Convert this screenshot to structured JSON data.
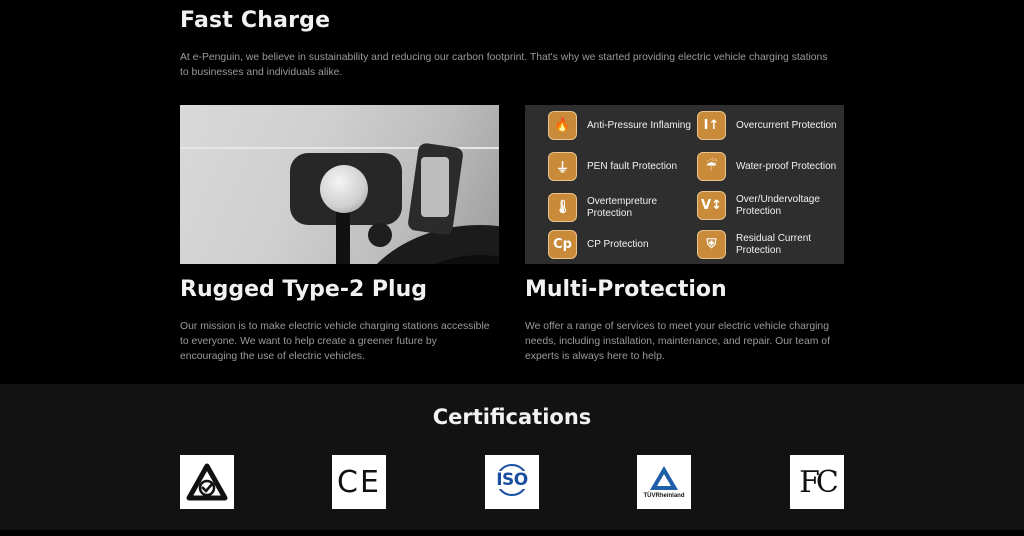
{
  "header": {
    "title": "Fast Charge"
  },
  "intro": {
    "text": "At e-Penguin, we believe in sustainability and reducing our carbon footprint. That's why we started providing electric vehicle charging stations to businesses and individuals alike."
  },
  "protections": [
    {
      "label": "Anti-Pressure Inflaming",
      "icon": "flame-icon",
      "glyph": "🔥"
    },
    {
      "label": "PEN fault Protection",
      "icon": "ground-icon",
      "glyph": "⏚"
    },
    {
      "label": "Overtempreture Protection",
      "icon": "thermometer-icon",
      "glyph": "🌡"
    },
    {
      "label": "CP Protection",
      "icon": "cp-icon",
      "glyph": "Cp"
    },
    {
      "label": "Overcurrent Protection",
      "icon": "current-icon",
      "glyph": "I↑"
    },
    {
      "label": "Water-proof Protection",
      "icon": "umbrella-icon",
      "glyph": "☔"
    },
    {
      "label": "Over/Undervoltage Protection",
      "icon": "voltage-icon",
      "glyph": "V↕"
    },
    {
      "label": "Residual Current Protection",
      "icon": "shield-icon",
      "glyph": "⛨"
    }
  ],
  "features": [
    {
      "title": "Rugged Type-2 Plug",
      "text": "Our mission is to make electric vehicle charging stations accessible to everyone. We want to help create a greener future by encouraging the use of electric vehicles."
    },
    {
      "title": "Multi-Protection",
      "text": "We offer a range of services to meet your electric vehicle charging needs, including installation, maintenance, and repair. Our team of experts is always here to help."
    }
  ],
  "certifications": {
    "title": "Certifications",
    "badges": [
      {
        "name": "rcm-logo",
        "text": ""
      },
      {
        "name": "ce-logo",
        "text": "CE"
      },
      {
        "name": "iso-logo",
        "text": "ISO"
      },
      {
        "name": "tuv-rheinland-logo",
        "text": "TÜVRheinland"
      },
      {
        "name": "fcc-logo",
        "text": "FC"
      }
    ]
  },
  "colors": {
    "background": "#000000",
    "section": "#121212",
    "accent": "#c98a3a",
    "text": "#f2f2f2",
    "muted": "#9a9a9a"
  }
}
